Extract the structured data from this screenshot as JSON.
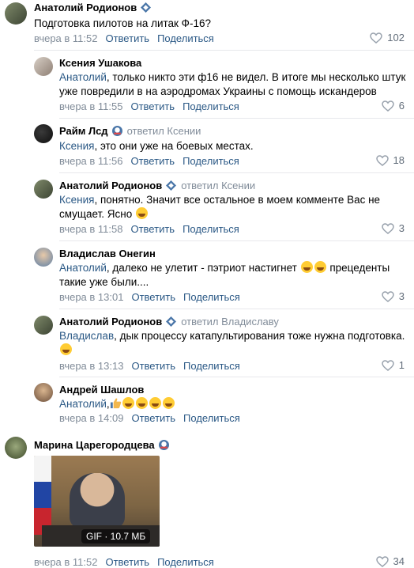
{
  "actions": {
    "reply": "Ответить",
    "share": "Поделиться"
  },
  "comments": [
    {
      "name": "Анатолий Родионов",
      "text": "Подготовка пилотов на литак Ф-16?",
      "time": "вчера в 11:52",
      "likes": "102"
    },
    {
      "name": "Ксения Ушакова",
      "mention": "Анатолий",
      "text": ", только никто эти ф16 не видел. В итоге мы несколько штук уже повредили в на аэродромах Украины с помощь искандеров",
      "time": "вчера в 11:55",
      "likes": "6"
    },
    {
      "name": "Райм Лсд",
      "replied": "ответил Ксении",
      "mention": "Ксения",
      "text": ", это они уже на боевых местах.",
      "time": "вчера в 11:56",
      "likes": "18"
    },
    {
      "name": "Анатолий Родионов",
      "replied": "ответил Ксении",
      "mention": "Ксения",
      "text": ", понятно. Значит все остальное в моем комменте Вас не смущает. Ясно",
      "time": "вчера в 11:58",
      "likes": "3"
    },
    {
      "name": "Владислав Онегин",
      "mention": "Анатолий",
      "text": ", далеко не улетит - пэтриот настигнет",
      "text2": "прецеденты такие уже были....",
      "time": "вчера в 13:01",
      "likes": "3"
    },
    {
      "name": "Анатолий Родионов",
      "replied": "ответил Владиславу",
      "mention": "Владислав",
      "text": ", дык процессу катапультирования тоже нужна подготовка.",
      "time": "вчера в 13:13",
      "likes": "1"
    },
    {
      "name": "Андрей Шашлов",
      "mention": "Анатолий",
      "text": ",",
      "time": "вчера в 14:09",
      "likes": ""
    },
    {
      "name": "Марина Царегородцева",
      "time": "вчера в 11:52",
      "likes": "34",
      "gif_label": "GIF · 10.7 МБ"
    }
  ],
  "colors": {
    "link": "#2a5885",
    "meta": "#818c99",
    "badge": "#4a76a8"
  }
}
